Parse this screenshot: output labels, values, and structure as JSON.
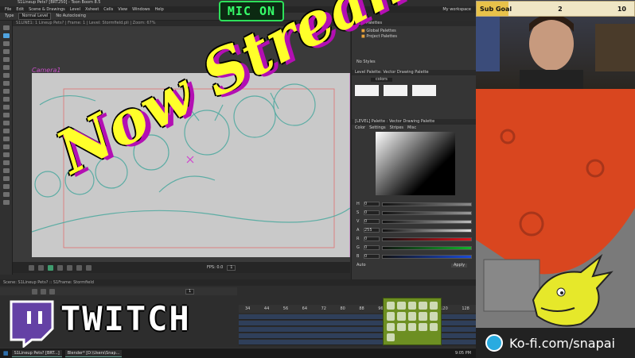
{
  "app": {
    "window_title": "S1Lineup Pets? [BRT250] - Toon Boom 8.5",
    "menu": [
      "File",
      "Edit",
      "Scene & Drawings",
      "Level",
      "Xsheet",
      "Cells",
      "View",
      "Windows",
      "Help"
    ],
    "workspace_label": "My workspace",
    "tool_options": {
      "type_label": "Type",
      "type_value": "Normal Level",
      "autoclose_label": "No Autoclosing"
    },
    "viewer_header": "S1LINE1: 1 Lineup Pets? | Frame: 1 | Level: Stormfield.pli | Zoom: 67%",
    "camera_label": "Camera1",
    "fps_label": "FPS: 0.0",
    "frame_field": "1",
    "frame_field_2": "1"
  },
  "panel": {
    "style_palettes": "Style Palettes",
    "global_palettes": "Global Palettes",
    "project_palettes": "Project Palettes",
    "no_styles": "No Styles",
    "level_palette": "Level Palette: Vector Drawing Palette",
    "style_name": "colors",
    "style_editor": "[LEVEL] Palette : Vector Drawing Palette",
    "style_tabs": [
      "Color",
      "Settings",
      "Stripes",
      "Misc"
    ],
    "sliders": [
      {
        "label": "H",
        "value": "0",
        "color": "#8a8a8a"
      },
      {
        "label": "S",
        "value": "0",
        "color": "#9a9a9a"
      },
      {
        "label": "V",
        "value": "0",
        "color": "#bbbbbb"
      },
      {
        "label": "A",
        "value": "255",
        "color": "#dcdcdc"
      },
      {
        "label": "R",
        "value": "0",
        "color": "#e0141d"
      },
      {
        "label": "G",
        "value": "0",
        "color": "#11b52b"
      },
      {
        "label": "B",
        "value": "0",
        "color": "#1b4bd8"
      }
    ],
    "auto_label": "Auto",
    "apply_label": "Apply"
  },
  "xsheet": {
    "title": "Scene: S1Lineup Pets? :: S1Frame: Stormfield",
    "frame_numbers": [
      "34",
      "44",
      "56",
      "64",
      "72",
      "80",
      "88",
      "96",
      "104",
      "112",
      "120",
      "128"
    ]
  },
  "taskbar": {
    "items": [
      "S1Lineup Pets? [BRT...]",
      "Blender* [D:\\Users\\Snap..."
    ],
    "clock": "9:05 PM"
  },
  "overlay": {
    "mic_status": "MIC ON",
    "headline": "Now Streaming!",
    "twitch_word": "TWITCH",
    "subgoal_label": "Sub Goal",
    "subgoal_current": "2",
    "subgoal_target": "10",
    "subgoal_fraction": 0.2,
    "kofi_text": "Ko-fi.com/snapai"
  },
  "colors": {
    "mic_green": "#2de05a",
    "headline_yellow": "#ffff2a",
    "headline_shadow": "#b30fb3",
    "heart_red": "#d9461f",
    "tray_green": "#6d8f22",
    "kofi_blue": "#29abe0",
    "dragon_yellow": "#e6e82a"
  },
  "icons": [
    "twitch-logo-icon",
    "ko-fi-cup-icon",
    "dragon-mascot-icon",
    "folder-icon",
    "play-icon"
  ]
}
